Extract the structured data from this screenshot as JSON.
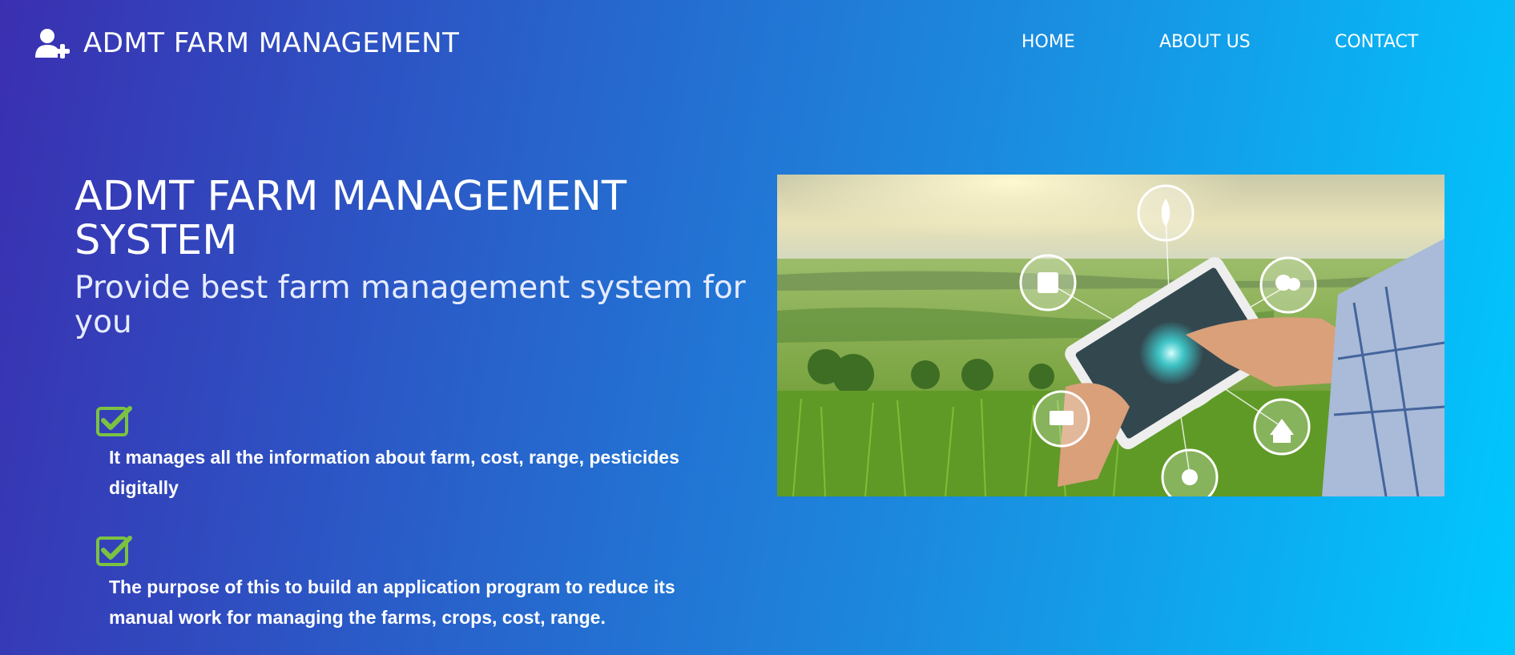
{
  "brand": {
    "name": "ADMT FARM MANAGEMENT",
    "icon": "user-plus-icon"
  },
  "nav": {
    "items": [
      {
        "label": "HOME"
      },
      {
        "label": "ABOUT US"
      },
      {
        "label": "CONTACT"
      }
    ]
  },
  "hero": {
    "title": "ADMT FARM MANAGEMENT SYSTEM",
    "subtitle": "Provide best farm management system for you",
    "features": [
      {
        "icon": "checkbox-checked-icon",
        "text": "It manages all the information about farm, cost, range, pesticides digitally"
      },
      {
        "icon": "checkbox-checked-icon",
        "text": "The purpose of this to build an application program to reduce its manual work for managing the farms, crops, cost, range."
      }
    ],
    "image": {
      "description_icons": [
        "plant-icon",
        "document-icon",
        "weather-icon",
        "money-icon",
        "barn-icon",
        "sun-icon",
        "tablet-icon"
      ]
    }
  },
  "colors": {
    "gradient_start": "#3a2fb0",
    "gradient_end": "#00c8ff",
    "check_green": "#7cc242",
    "text": "#ffffff"
  }
}
